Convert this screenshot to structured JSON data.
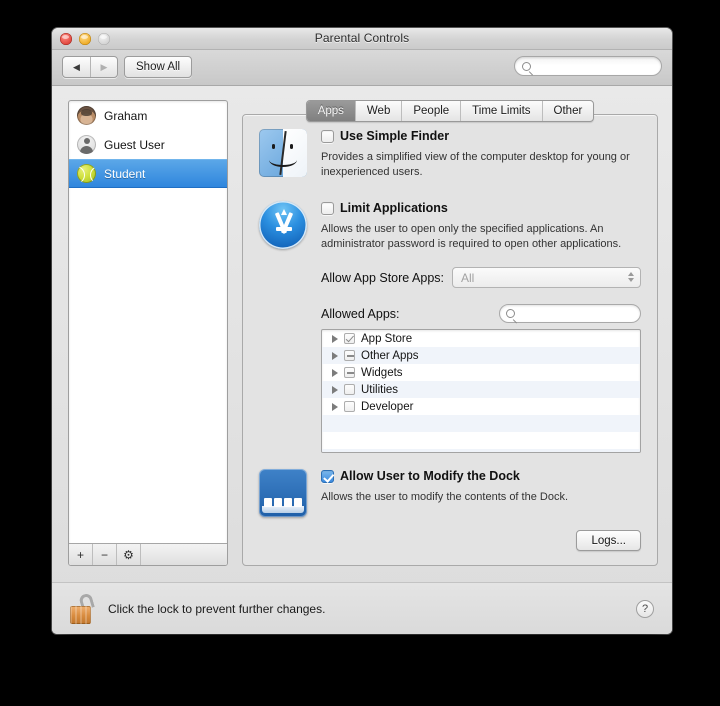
{
  "window": {
    "title": "Parental Controls",
    "traffic_lights": [
      "close",
      "minimize",
      "zoom"
    ]
  },
  "toolbar": {
    "back_icon": "triangle-left-icon",
    "forward_icon": "triangle-right-icon",
    "show_all_label": "Show All",
    "search_value": "",
    "search_placeholder": "",
    "search_icon": "search-icon"
  },
  "sidebar": {
    "users": [
      {
        "name": "Graham",
        "avatar": "photo-avatar",
        "selected": false
      },
      {
        "name": "Guest User",
        "avatar": "silhouette-avatar",
        "selected": false
      },
      {
        "name": "Student",
        "avatar": "tennis-ball-avatar",
        "selected": true
      }
    ],
    "buttons": [
      {
        "label": "+",
        "name": "add-user-button"
      },
      {
        "label": "−",
        "name": "remove-user-button"
      },
      {
        "label": "⚙",
        "name": "settings-gear-button"
      }
    ]
  },
  "tabs": [
    {
      "label": "Apps",
      "active": true
    },
    {
      "label": "Web",
      "active": false
    },
    {
      "label": "People",
      "active": false
    },
    {
      "label": "Time Limits",
      "active": false
    },
    {
      "label": "Other",
      "active": false
    }
  ],
  "simple_finder": {
    "icon": "finder-face-icon",
    "label": "Use Simple Finder",
    "checked": false,
    "description": "Provides a simplified view of the computer desktop for young or inexperienced users."
  },
  "limit_applications": {
    "icon": "app-store-icon",
    "label": "Limit Applications",
    "checked": false,
    "description": "Allows the user to open only the specified applications. An administrator password is required to open other applications."
  },
  "app_store_popup": {
    "label": "Allow App Store Apps:",
    "value": "All",
    "disabled": true
  },
  "allowed_apps": {
    "label": "Allowed Apps:",
    "search_value": "",
    "search_icon": "search-icon",
    "rows": [
      {
        "label": "App Store",
        "state": "checked"
      },
      {
        "label": "Other Apps",
        "state": "mixed"
      },
      {
        "label": "Widgets",
        "state": "mixed"
      },
      {
        "label": "Utilities",
        "state": "unchecked"
      },
      {
        "label": "Developer",
        "state": "unchecked"
      }
    ]
  },
  "dock": {
    "icon": "dock-icon",
    "label": "Allow User to Modify the Dock",
    "checked": true,
    "description": "Allows the user to modify the contents of the Dock."
  },
  "logs_button": {
    "label": "Logs..."
  },
  "footer": {
    "lock_icon": "unlocked-padlock-icon",
    "text": "Click the lock to prevent further changes.",
    "help_label": "?"
  },
  "colors": {
    "selection_blue": "#2f86dd",
    "checkbox_blue": "#3b8ade",
    "lock_orange": "#d88b3e",
    "tab_active_gray": "#808080"
  }
}
